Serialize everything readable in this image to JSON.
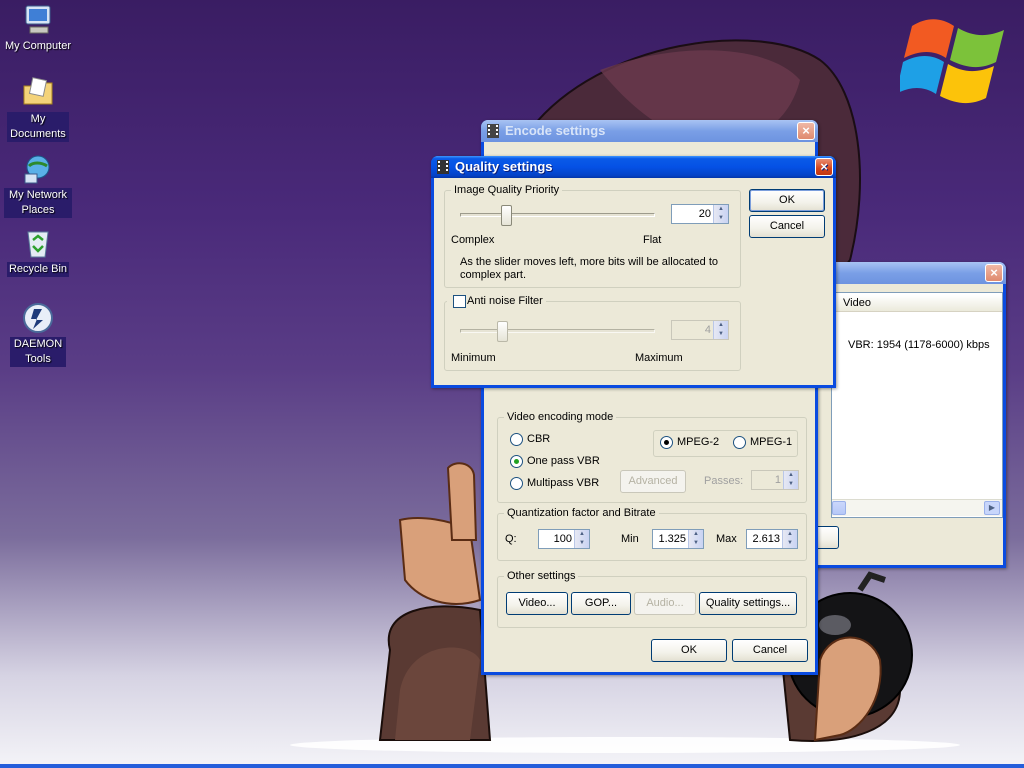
{
  "desktop": {
    "icons": [
      {
        "label": "My Computer"
      },
      {
        "label": "My Documents"
      },
      {
        "label": "My Network Places"
      },
      {
        "label": "Recycle Bin"
      },
      {
        "label": "DAEMON Tools"
      }
    ]
  },
  "colors": {
    "title_active": "#0551e5",
    "title_inactive": "#7a9fe6",
    "dialog_bg": "#ece9d8",
    "close_red": "#d4441b"
  },
  "background_window": {
    "list_header": "Video",
    "list_row": "VBR: 1954 (1178-6000) kbps"
  },
  "encode": {
    "title": "Encode settings",
    "video_mode": {
      "group": "Video encoding mode",
      "cbr": "CBR",
      "one_pass": "One pass VBR",
      "multipass": "Multipass VBR",
      "mpeg2": "MPEG-2",
      "mpeg1": "MPEG-1",
      "advanced": "Advanced",
      "passes_label": "Passes:",
      "passes_value": "1",
      "selected_mode": "One pass VBR",
      "selected_format": "MPEG-2"
    },
    "quant": {
      "group": "Quantization factor and Bitrate",
      "q_label": "Q:",
      "q_value": "100",
      "min_label": "Min",
      "min_value": "1.325",
      "max_label": "Max",
      "max_value": "2.613"
    },
    "other": {
      "group": "Other settings",
      "video": "Video...",
      "gop": "GOP...",
      "audio": "Audio...",
      "quality": "Quality settings..."
    },
    "ok": "OK",
    "cancel": "Cancel"
  },
  "quality": {
    "title": "Quality settings",
    "priority": {
      "group": "Image Quality Priority",
      "value": "20",
      "level": 0.2,
      "left_label": "Complex",
      "right_label": "Flat",
      "desc_line1": "As the slider moves left, more bits will be allocated to",
      "desc_line2": "complex part."
    },
    "noise": {
      "checkbox_label": "Anti noise Filter",
      "checked": false,
      "value": "4",
      "level": 0.2,
      "left_label": "Minimum",
      "right_label": "Maximum"
    },
    "ok": "OK",
    "cancel": "Cancel"
  }
}
